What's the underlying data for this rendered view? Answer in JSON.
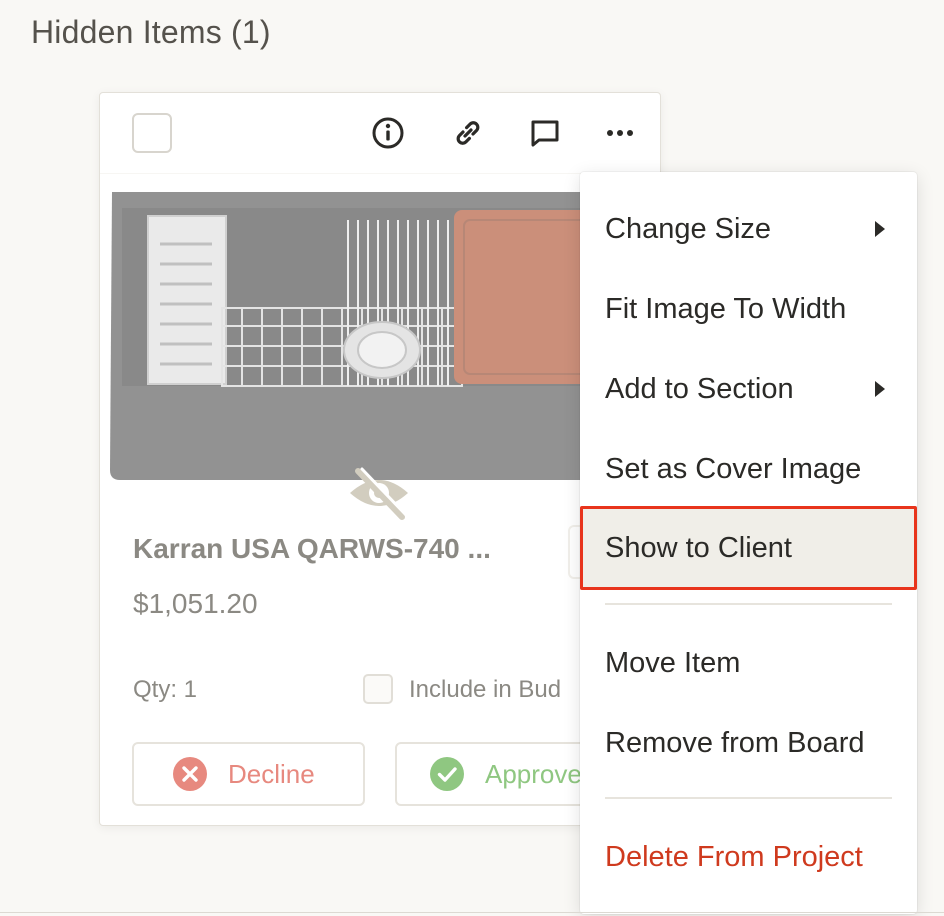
{
  "section": {
    "title": "Hidden Items (1)"
  },
  "card": {
    "product_name": "Karran USA QARWS-740 ...",
    "price": "$1,051.20",
    "qty_label": "Qty: 1",
    "budget_label": "Include in Bud",
    "decline_label": "Decline",
    "approve_label": "Approve",
    "toolbar_icons": [
      "info-icon",
      "link-icon",
      "comment-icon",
      "more-icon"
    ],
    "status_icon": "hidden-eye-icon"
  },
  "menu": {
    "items": [
      {
        "label": "Change Size",
        "submenu": true
      },
      {
        "label": "Fit Image To Width",
        "submenu": false
      },
      {
        "label": "Add to Section",
        "submenu": true
      },
      {
        "label": "Set as Cover Image",
        "submenu": false
      },
      {
        "label": "Show to Client",
        "submenu": false,
        "highlighted": true
      },
      {
        "label": "Move Item",
        "submenu": false
      },
      {
        "label": "Remove from Board",
        "submenu": false
      },
      {
        "label": "Delete From Project",
        "submenu": false,
        "danger": true
      }
    ]
  },
  "colors": {
    "highlight_border": "#e8341c",
    "danger_text": "#cf3a1e",
    "decline": "#e7897f",
    "approve": "#8fc781",
    "background": "#f9f8f5"
  }
}
